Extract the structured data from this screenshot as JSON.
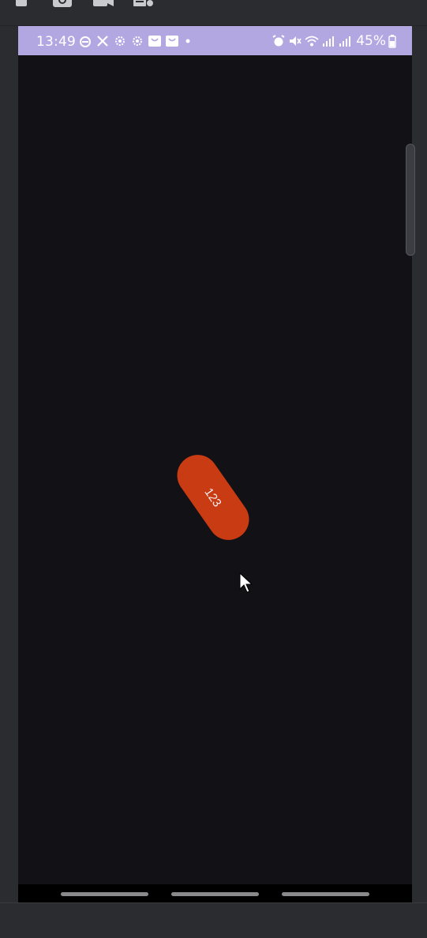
{
  "host": {
    "toolbar_icons": [
      "stop-icon",
      "screenshot-camera-icon",
      "screen-record-icon",
      "extended-controls-icon"
    ]
  },
  "status_bar": {
    "time": "13:49",
    "battery": "45%",
    "background_color": "#b3a7e2",
    "left_icons": [
      "android-head-icon",
      "x-icon",
      "gear-icon",
      "gear-icon",
      "shopping-bag-icon",
      "shopping-bag-icon",
      "dot-icon"
    ],
    "right_icons": [
      "alarm-icon",
      "mute-icon",
      "wifi-icon",
      "signal-icon",
      "signal-icon"
    ]
  },
  "content": {
    "pill_label": "123",
    "pill_color": "#c93b13",
    "background_color": "#121115"
  }
}
